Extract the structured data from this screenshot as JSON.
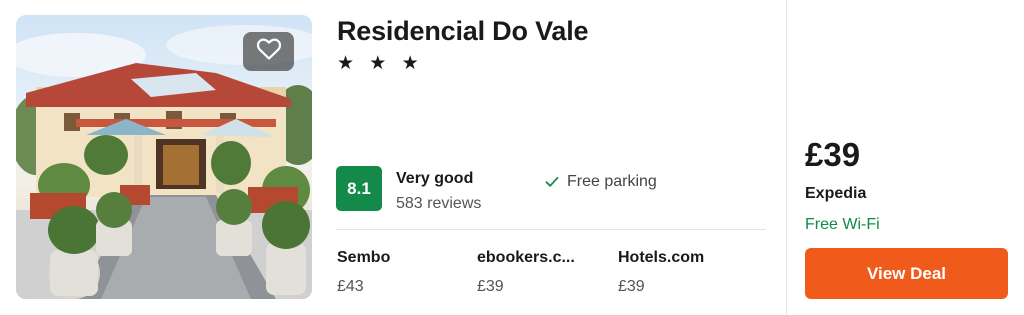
{
  "hotel": {
    "name": "Residencial Do Vale",
    "stars": "★ ★ ★",
    "photo_icon": "hotel-photo",
    "favorite_icon": "heart-outline-icon"
  },
  "rating": {
    "score": "8.1",
    "label": "Very good",
    "reviews": "583 reviews",
    "badge_color": "#138a4a"
  },
  "amenities": [
    {
      "label": "Free parking",
      "icon": "check-icon"
    }
  ],
  "providers": [
    {
      "name": "Sembo",
      "price": "£43"
    },
    {
      "name": "ebookers.c...",
      "price": "£39"
    },
    {
      "name": "Hotels.com",
      "price": "£39"
    }
  ],
  "deal": {
    "price": "£39",
    "provider": "Expedia",
    "perk": "Free Wi-Fi",
    "button_label": "View Deal",
    "button_color": "#f05a1a"
  }
}
